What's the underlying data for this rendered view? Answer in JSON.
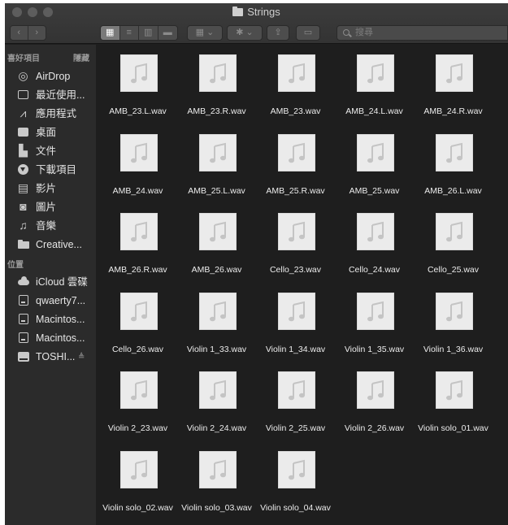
{
  "window": {
    "title": "Strings",
    "search_placeholder": "搜尋"
  },
  "toolbar": {
    "back_icon": "chevron-left-icon",
    "forward_icon": "chevron-right-icon",
    "views": [
      "icon-view-icon",
      "list-view-icon",
      "column-view-icon",
      "gallery-view-icon"
    ],
    "active_view": "icon-view-icon",
    "group_icon": "group-by-icon",
    "action_icon": "gear-icon",
    "share_icon": "share-icon",
    "tags_icon": "tag-icon",
    "chevron": "⌄"
  },
  "sidebar": {
    "favorites_header": "喜好項目",
    "hide_label": "隱藏",
    "favorites": [
      {
        "label": "AirDrop",
        "icon": "airdrop-icon"
      },
      {
        "label": "最近使用...",
        "icon": "recents-icon"
      },
      {
        "label": "應用程式",
        "icon": "applications-icon"
      },
      {
        "label": "桌面",
        "icon": "desktop-icon"
      },
      {
        "label": "文件",
        "icon": "documents-icon"
      },
      {
        "label": "下載項目",
        "icon": "downloads-icon"
      },
      {
        "label": "影片",
        "icon": "movies-icon"
      },
      {
        "label": "圖片",
        "icon": "pictures-icon"
      },
      {
        "label": "音樂",
        "icon": "music-icon"
      },
      {
        "label": "Creative...",
        "icon": "folder-icon"
      }
    ],
    "locations_header": "位置",
    "locations": [
      {
        "label": "iCloud 雲碟",
        "icon": "cloud-icon"
      },
      {
        "label": "qwaerty7...",
        "icon": "disk-icon"
      },
      {
        "label": "Macintos...",
        "icon": "disk-icon"
      },
      {
        "label": "Macintos...",
        "icon": "disk-icon"
      },
      {
        "label": "TOSHI...",
        "icon": "external-drive-icon",
        "eject": "≜"
      }
    ]
  },
  "files": [
    "AMB_23.L.wav",
    "AMB_23.R.wav",
    "AMB_23.wav",
    "AMB_24.L.wav",
    "AMB_24.R.wav",
    "AMB_24.wav",
    "AMB_25.L.wav",
    "AMB_25.R.wav",
    "AMB_25.wav",
    "AMB_26.L.wav",
    "AMB_26.R.wav",
    "AMB_26.wav",
    "Cello_23.wav",
    "Cello_24.wav",
    "Cello_25.wav",
    "Cello_26.wav",
    "Violin 1_33.wav",
    "Violin 1_34.wav",
    "Violin 1_35.wav",
    "Violin 1_36.wav",
    "Violin 2_23.wav",
    "Violin 2_24.wav",
    "Violin 2_25.wav",
    "Violin 2_26.wav",
    "Violin solo_01.wav",
    "Violin solo_02.wav",
    "Violin solo_03.wav",
    "Violin solo_04.wav"
  ],
  "file_icon": "audio-file-icon",
  "colors": {
    "window_bg": "#1e1e1e",
    "sidebar_bg": "#2b2b2b",
    "titlebar_bg": "#383838",
    "thumb_bg": "#ebebeb",
    "note_color": "#c4c4c4"
  }
}
